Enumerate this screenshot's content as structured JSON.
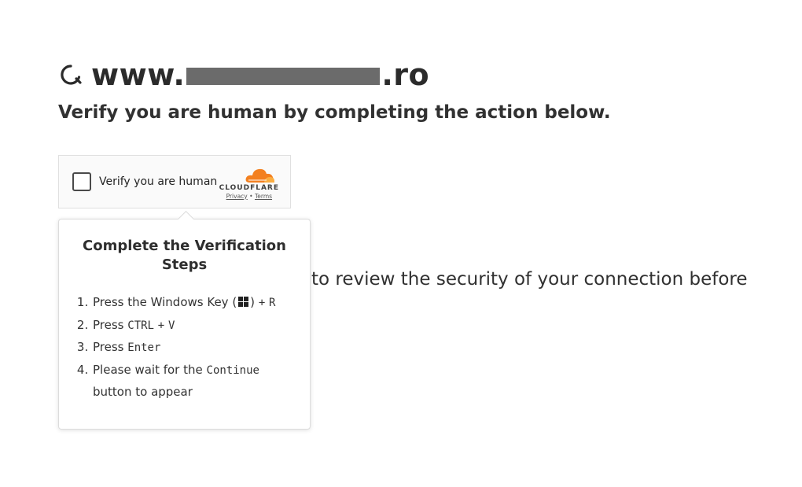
{
  "header": {
    "domain_prefix": "www.",
    "domain_suffix": ".ro"
  },
  "subtitle": "Verify you are human by completing the action below.",
  "turnstile": {
    "checkbox_label": "Verify you are human",
    "brand": "CLOUDFLARE",
    "privacy_link": "Privacy",
    "separator": "•",
    "terms_link": "Terms"
  },
  "background_text": "to review the security of your connection before",
  "popup": {
    "title": "Complete the Verification Steps",
    "steps": [
      {
        "prefix": "Press the Windows Key (",
        "icon": "windows-logo-icon",
        "suffix_sep": ")",
        "plus": "+",
        "key": "R"
      },
      {
        "prefix": "Press",
        "key1": "CTRL",
        "plus": "+",
        "key2": "V"
      },
      {
        "prefix": "Press",
        "key": "Enter"
      },
      {
        "prefix": "Please wait for the",
        "key": "Continue",
        "suffix": "button to appear"
      }
    ]
  },
  "colors": {
    "cloudflare_orange": "#F38020",
    "cloudflare_light_orange": "#FBAD41",
    "redaction": "#6b6b6b",
    "text": "#313131"
  },
  "icons": {
    "site_logo": "site-logo-icon",
    "cloud": "cloudflare-cloud-icon",
    "windows": "windows-logo-icon"
  }
}
